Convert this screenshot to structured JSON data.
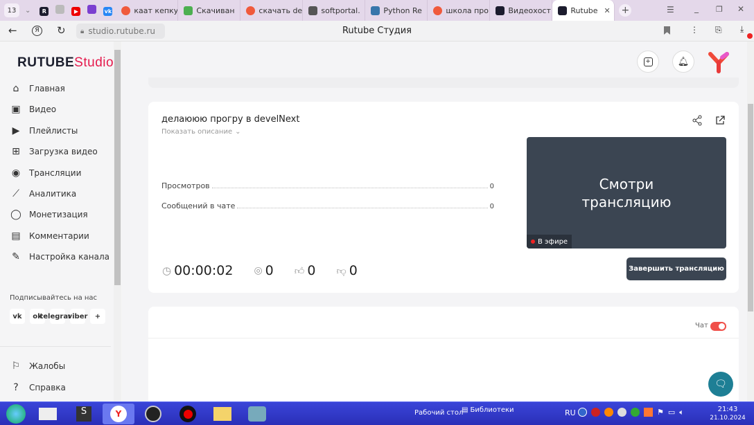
{
  "browser": {
    "tab_count": "13",
    "tabs": [
      {
        "label": "каат кепку",
        "icon": "yandex-icon",
        "color": "#f05a3c"
      },
      {
        "label": "Скачиван",
        "icon": "download-app-icon",
        "color": "#4caf50"
      },
      {
        "label": "скачать de",
        "icon": "yandex-icon",
        "color": "#f05a3c"
      },
      {
        "label": "softportal.",
        "icon": "page-icon",
        "color": "#555555"
      },
      {
        "label": "Python Re",
        "icon": "python-icon",
        "color": "#3776ab"
      },
      {
        "label": "школа про",
        "icon": "yandex-icon",
        "color": "#f05a3c"
      },
      {
        "label": "Видеохост",
        "icon": "rutube-icon",
        "color": "#1c1c2e"
      },
      {
        "label": "Rutube",
        "icon": "rutube-icon",
        "color": "#1c1c2e",
        "active": true
      }
    ],
    "url": "studio.rutube.ru",
    "page_title": "Rutube Студия"
  },
  "app": {
    "logo_main": "RUTUBE",
    "logo_sub": "Studio",
    "brand_color": "#e5194c",
    "nav": [
      {
        "label": "Главная",
        "icon": "home-icon"
      },
      {
        "label": "Видео",
        "icon": "tv-icon"
      },
      {
        "label": "Плейлисты",
        "icon": "playlist-icon"
      },
      {
        "label": "Загрузка видео",
        "icon": "upload-video-icon"
      },
      {
        "label": "Трансляции",
        "icon": "broadcast-icon"
      },
      {
        "label": "Аналитика",
        "icon": "analytics-icon"
      },
      {
        "label": "Монетизация",
        "icon": "coin-icon"
      },
      {
        "label": "Комментарии",
        "icon": "comments-icon"
      },
      {
        "label": "Настройка канала",
        "icon": "magic-wand-icon"
      }
    ],
    "subscribe_label": "Подписывайтесь на нас",
    "socials": [
      "vk",
      "ok",
      "telegram",
      "viber",
      "+"
    ],
    "bottom_nav": [
      {
        "label": "Жалобы",
        "icon": "flag-icon"
      },
      {
        "label": "Справка",
        "icon": "help-icon"
      }
    ]
  },
  "stream": {
    "title": "делаююю прогру в develNext",
    "show_description": "Показать описание",
    "stats": [
      {
        "label": "Просмотров",
        "value": "0"
      },
      {
        "label": "Сообщений в чате",
        "value": "0"
      }
    ],
    "duration": "00:00:02",
    "viewers": "0",
    "likes": "0",
    "dislikes": "0",
    "preview_text_1": "Смотри",
    "preview_text_2": "трансляцию",
    "live_badge": "В эфире",
    "end_button": "Завершить трансляцию",
    "chat_label": "Чат",
    "chat_enabled": true
  },
  "taskbar": {
    "desktop": "Рабочий стол",
    "libraries": "Библиотеки",
    "lang": "RU",
    "time": "21:43",
    "date": "21.10.2024"
  }
}
